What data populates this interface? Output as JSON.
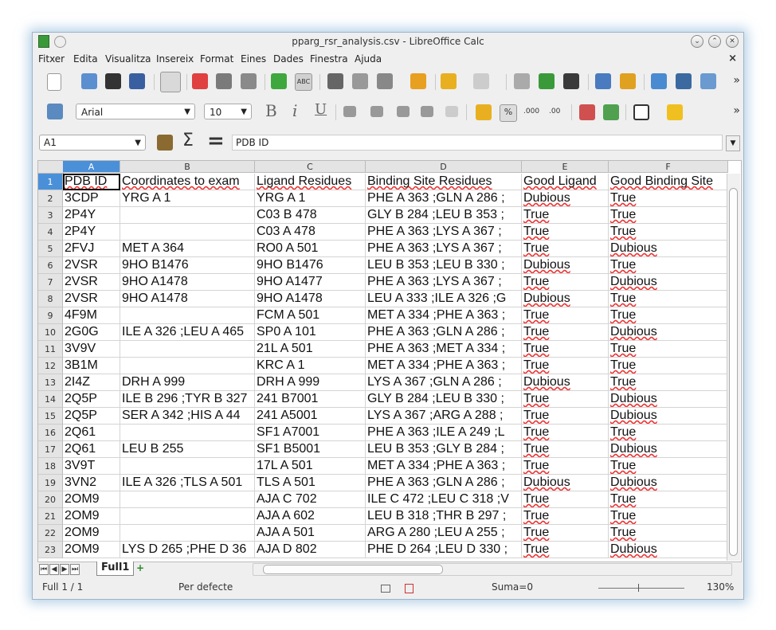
{
  "window": {
    "title": "pparg_rsr_analysis.csv - LibreOffice Calc",
    "controls": [
      "minimize",
      "maximize",
      "close"
    ]
  },
  "menubar": {
    "items": [
      "Fitxer",
      "Edita",
      "Visualitza",
      "Insereix",
      "Format",
      "Eines",
      "Dades",
      "Finestra",
      "Ajuda"
    ],
    "close_glyph": "×"
  },
  "toolbar1": {
    "icons": [
      "new-document-icon",
      "open-icon",
      "save-icon",
      "save-as-icon",
      "edit-mode-icon",
      "export-pdf-icon",
      "print-direct-icon",
      "print-preview-icon",
      "spellcheck-icon",
      "autospellcheck-icon",
      "cut-icon",
      "copy-icon",
      "paste-icon",
      "clone-formatting-icon",
      "undo-icon",
      "redo-icon",
      "hyperlink-icon",
      "sort-ascending-icon",
      "sort-descending-icon",
      "chart-icon",
      "draw-functions-icon",
      "navigator-icon",
      "gallery-icon",
      "data-sources-icon"
    ],
    "abc_label": "ABC",
    "more": "»"
  },
  "toolbar2": {
    "font_name": "Arial",
    "font_size": "10",
    "bold": "B",
    "italic": "i",
    "underline": "U",
    "percent": "%",
    "add_decimal": ".000",
    "del_decimal": ".00",
    "more": "»"
  },
  "formula_bar": {
    "name_box": "A1",
    "content": "PDB ID",
    "sum_glyph": "Σ",
    "equals_glyph": "="
  },
  "sheet": {
    "columns": [
      "A",
      "B",
      "C",
      "D",
      "E",
      "F"
    ],
    "selected_column": "A",
    "selected_cell": "A1",
    "rows": [
      {
        "n": "1",
        "cells": [
          "PDB ID",
          "Coordinates to exam",
          "Ligand Residues",
          "Binding Site Residues",
          "Good Ligand",
          "Good Binding Site"
        ]
      },
      {
        "n": "2",
        "cells": [
          "3CDP",
          "YRG A   1",
          "YRG A   1",
          "PHE A 363 ;GLN A 286 ;",
          "Dubious",
          "True"
        ]
      },
      {
        "n": "3",
        "cells": [
          "2P4Y",
          "",
          "C03 B 478",
          "GLY B 284 ;LEU B 353 ;",
          "True",
          "True"
        ]
      },
      {
        "n": "4",
        "cells": [
          "2P4Y",
          "",
          "C03 A 478",
          "PHE A 363 ;LYS A 367 ;",
          "True",
          "True"
        ]
      },
      {
        "n": "5",
        "cells": [
          "2FVJ",
          "MET A 364",
          "RO0 A 501",
          "PHE A 363 ;LYS A 367 ;",
          "True",
          "Dubious"
        ]
      },
      {
        "n": "6",
        "cells": [
          "2VSR",
          "9HO B1476",
          "9HO B1476",
          "LEU B 353 ;LEU B 330 ;",
          "Dubious",
          "True"
        ]
      },
      {
        "n": "7",
        "cells": [
          "2VSR",
          "9HO A1478",
          "9HO A1477",
          "PHE A 363 ;LYS A 367 ;",
          "True",
          "Dubious"
        ]
      },
      {
        "n": "8",
        "cells": [
          "2VSR",
          "9HO A1478",
          "9HO A1478",
          "LEU A 333 ;ILE A 326 ;G",
          "Dubious",
          "True"
        ]
      },
      {
        "n": "9",
        "cells": [
          "4F9M",
          "",
          "FCM A 501",
          "MET A 334 ;PHE A 363 ;",
          "True",
          "True"
        ]
      },
      {
        "n": "10",
        "cells": [
          "2G0G",
          "ILE A 326 ;LEU A 465",
          "SP0 A 101",
          "PHE A 363 ;GLN A 286 ;",
          "True",
          "Dubious"
        ]
      },
      {
        "n": "11",
        "cells": [
          "3V9V",
          "",
          "21L A 501",
          "PHE A 363 ;MET A 334 ;",
          "True",
          "True"
        ]
      },
      {
        "n": "12",
        "cells": [
          "3B1M",
          "",
          "KRC A   1",
          "MET A 334 ;PHE A 363 ;",
          "True",
          "True"
        ]
      },
      {
        "n": "13",
        "cells": [
          "2I4Z",
          "DRH A 999",
          "DRH A 999",
          "LYS A 367 ;GLN A 286 ;",
          "Dubious",
          "True"
        ]
      },
      {
        "n": "14",
        "cells": [
          "2Q5P",
          "ILE B 296 ;TYR B 327",
          "241 B7001",
          "GLY B 284 ;LEU B 330 ;",
          "True",
          "Dubious"
        ]
      },
      {
        "n": "15",
        "cells": [
          "2Q5P",
          "SER A 342 ;HIS A 44",
          "241 A5001",
          "LYS A 367 ;ARG A 288 ;",
          "True",
          "Dubious"
        ]
      },
      {
        "n": "16",
        "cells": [
          "2Q61",
          "",
          "SF1 A7001",
          "PHE A 363 ;ILE A 249 ;L",
          "True",
          "True"
        ]
      },
      {
        "n": "17",
        "cells": [
          "2Q61",
          "LEU B 255",
          "SF1 B5001",
          "LEU B 353 ;GLY B 284 ;",
          "True",
          "Dubious"
        ]
      },
      {
        "n": "18",
        "cells": [
          "3V9T",
          "",
          "17L A 501",
          "MET A 334 ;PHE A 363 ;",
          "True",
          "True"
        ]
      },
      {
        "n": "19",
        "cells": [
          "3VN2",
          "ILE A 326 ;TLS A 501",
          "TLS A 501",
          "PHE A 363 ;GLN A 286 ;",
          "Dubious",
          "Dubious"
        ]
      },
      {
        "n": "20",
        "cells": [
          "2OM9",
          "",
          "AJA C 702",
          "ILE C 472 ;LEU C 318 ;V",
          "True",
          "True"
        ]
      },
      {
        "n": "21",
        "cells": [
          "2OM9",
          "",
          "AJA A 602",
          "LEU B 318 ;THR B 297 ;",
          "True",
          "True"
        ]
      },
      {
        "n": "22",
        "cells": [
          "2OM9",
          "",
          "AJA A 501",
          "ARG A 280 ;LEU A 255 ;",
          "True",
          "True"
        ]
      },
      {
        "n": "23",
        "cells": [
          "2OM9",
          "LYS D 265 ;PHE D 36",
          "AJA D 802",
          "PHE D 264 ;LEU D 330 ;",
          "True",
          "Dubious"
        ]
      }
    ]
  },
  "sheet_tabs": {
    "active": "Full1",
    "add_glyph": "+"
  },
  "statusbar": {
    "sheet_info": "Full 1 / 1",
    "page_style": "Per defecte",
    "sum": "Suma=0",
    "zoom": "130%"
  }
}
